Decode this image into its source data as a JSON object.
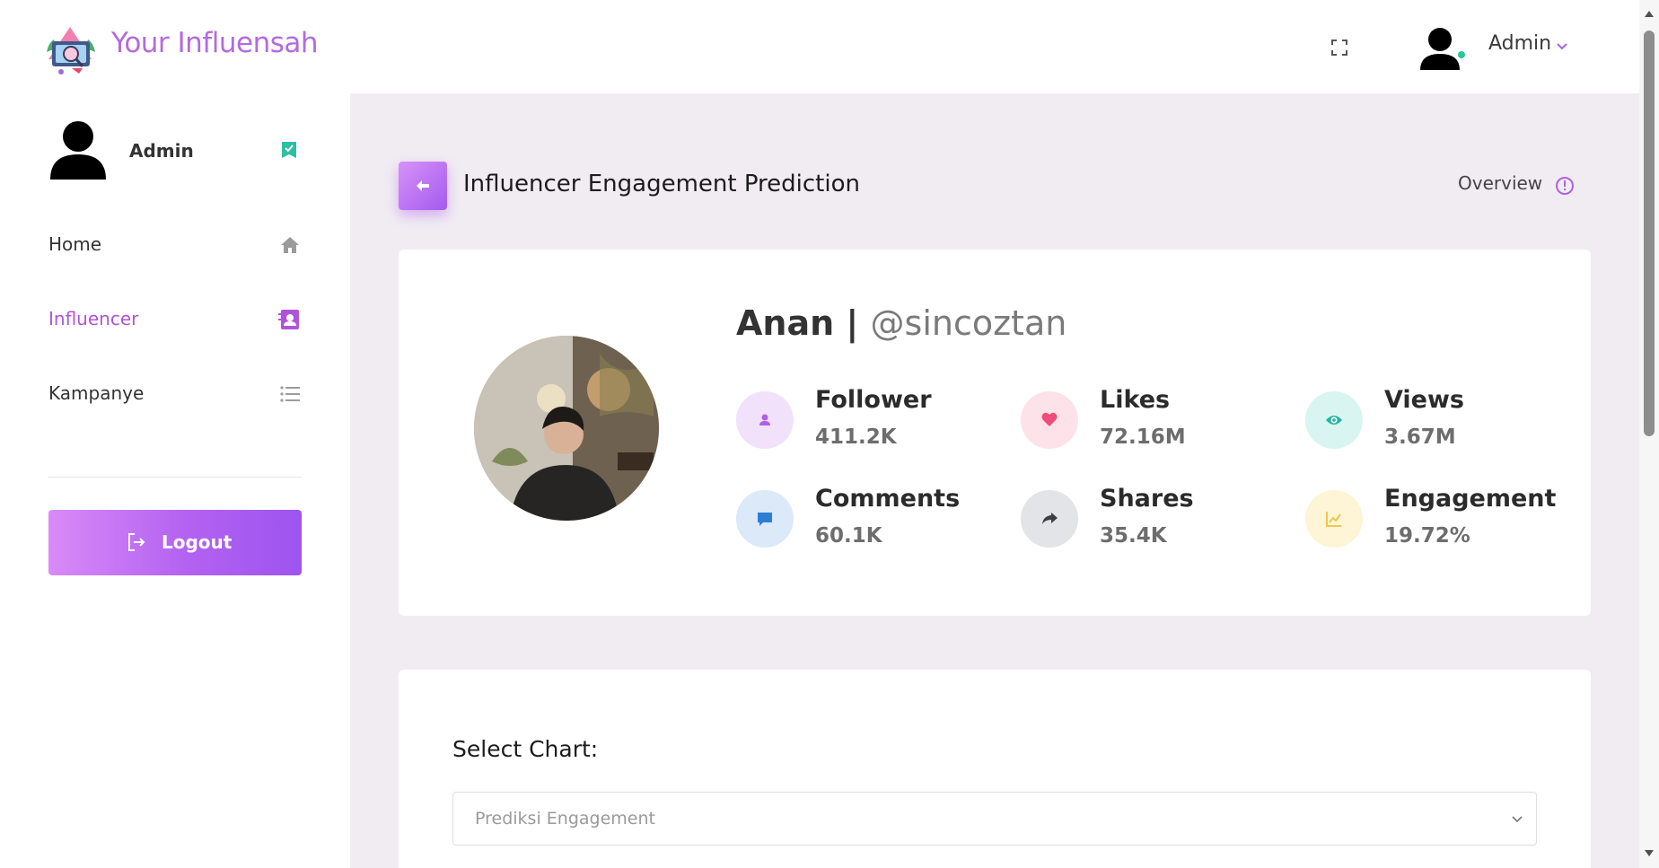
{
  "app": {
    "brand": "Your Influensah"
  },
  "header": {
    "user_name": "Admin"
  },
  "sidebar": {
    "user_name": "Admin",
    "items": [
      {
        "label": "Home",
        "icon": "home-icon"
      },
      {
        "label": "Influencer",
        "icon": "contact-book-icon",
        "active": true
      },
      {
        "label": "Kampanye",
        "icon": "list-icon"
      }
    ],
    "logout_label": "Logout"
  },
  "page": {
    "title": "Influencer Engagement Prediction",
    "overview_label": "Overview"
  },
  "profile": {
    "name": "Anan",
    "separator": "|",
    "handle": "@sincoztan",
    "stats": [
      {
        "label": "Follower",
        "value": "411.2K",
        "icon": "user-icon",
        "color": "#b05fe3",
        "bg": "#f1e1fb"
      },
      {
        "label": "Likes",
        "value": "72.16M",
        "icon": "heart-icon",
        "color": "#ee4d7a",
        "bg": "#fde2ea"
      },
      {
        "label": "Views",
        "value": "3.67M",
        "icon": "eye-icon",
        "color": "#22b5a2",
        "bg": "#d8f5f1"
      },
      {
        "label": "Comments",
        "value": "60.1K",
        "icon": "comment-icon",
        "color": "#2d7fd3",
        "bg": "#dbe9f8"
      },
      {
        "label": "Shares",
        "value": "35.4K",
        "icon": "share-icon",
        "color": "#3b3f46",
        "bg": "#e2e4e7"
      },
      {
        "label": "Engagement",
        "value": "19.72%",
        "icon": "chart-line-icon",
        "color": "#f0c64a",
        "bg": "#fdf5d5"
      }
    ]
  },
  "chart_select": {
    "label": "Select Chart:",
    "selected": "Prediksi Engagement"
  }
}
